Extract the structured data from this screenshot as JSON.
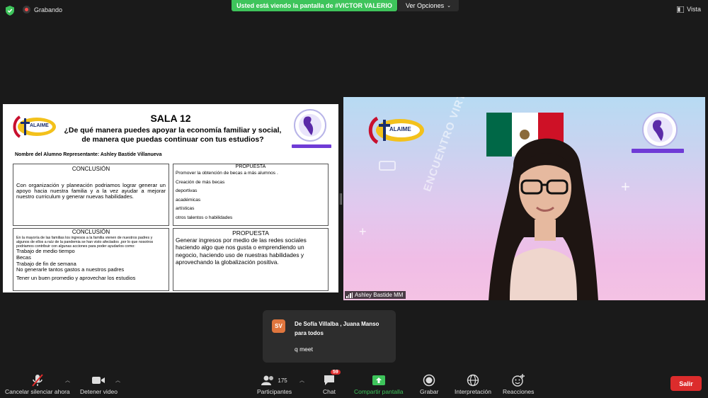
{
  "topbar": {
    "recording_label": "Grabando",
    "share_banner": "Usted está viendo la pantalla de #VICTOR VALERIO",
    "view_options": "Ver Opciones",
    "view_label": "Vista"
  },
  "slide": {
    "title": "SALA 12",
    "question": "¿De qué manera puedes apoyar la economía familiar y social, de manera que puedas continuar con tus estudios?",
    "student_label": "Nombre del Alumno Representante: Ashley Bastide Villanueva",
    "logo_text": "ALAIME",
    "box1": {
      "header": "CONCLUSIÓN",
      "text": "Con organización y planeación podriamos lograr generar un apoyo hacia nuestra familia y a la vez ayudar a mejorar nuestro curriculum y generar nuevas habilidades."
    },
    "box2": {
      "header": "PROPUESTA",
      "items": [
        "Promover la obtención de becas a más alumnos .",
        "Creación de más becas",
        "deportivas",
        "académicas",
        "artísticas",
        "otros talentos o habilidades"
      ]
    },
    "box3": {
      "header": "CONCLUSIÓN",
      "intro": "En la mayoría de las familias los ingresos a la familia vienen de nuestros padres y algunos de ellos a raíz de la pandemia se han visto afectados ,por lo que nosotros podriamos contribuir con algunas acciones para poder ayudarlos como:",
      "items": [
        "Trabajo de medio tiempo",
        "Becas",
        "Trabajo de fin de semana",
        "No generarle tantos gastos a nuestros padres",
        "Tener un buen promedio y aprovechar los estudios"
      ]
    },
    "box4": {
      "header": "PROPUESTA",
      "text": "Generar ingresos por medio de las redes sociales haciendo algo que nos gusta o emprendiendo un negocio, haciendo uso de nuestras habilidades y aprovechando la globalización positiva."
    }
  },
  "video": {
    "participant_name": "Ashley Bastide MM",
    "logo_text": "ALAIME",
    "bg_text": "ENCUENTRO VIRTUAL"
  },
  "chat_popup": {
    "avatar_initials": "SV",
    "from": "De Sofía Villalba , Juana Manso para todos",
    "message": "q meet"
  },
  "toolbar": {
    "mute_label": "Cancelar silenciar ahora",
    "video_label": "Detener video",
    "participants_label": "Participantes",
    "participants_count": "175",
    "chat_label": "Chat",
    "chat_badge": "59",
    "share_label": "Compartir pantalla",
    "record_label": "Grabar",
    "interpretation_label": "Interpretación",
    "reactions_label": "Reacciones",
    "leave_label": "Salir"
  },
  "colors": {
    "share_green": "#3ec45b",
    "leave_red": "#dc2c2c",
    "toolbar_bg": "#1a1a1a"
  }
}
